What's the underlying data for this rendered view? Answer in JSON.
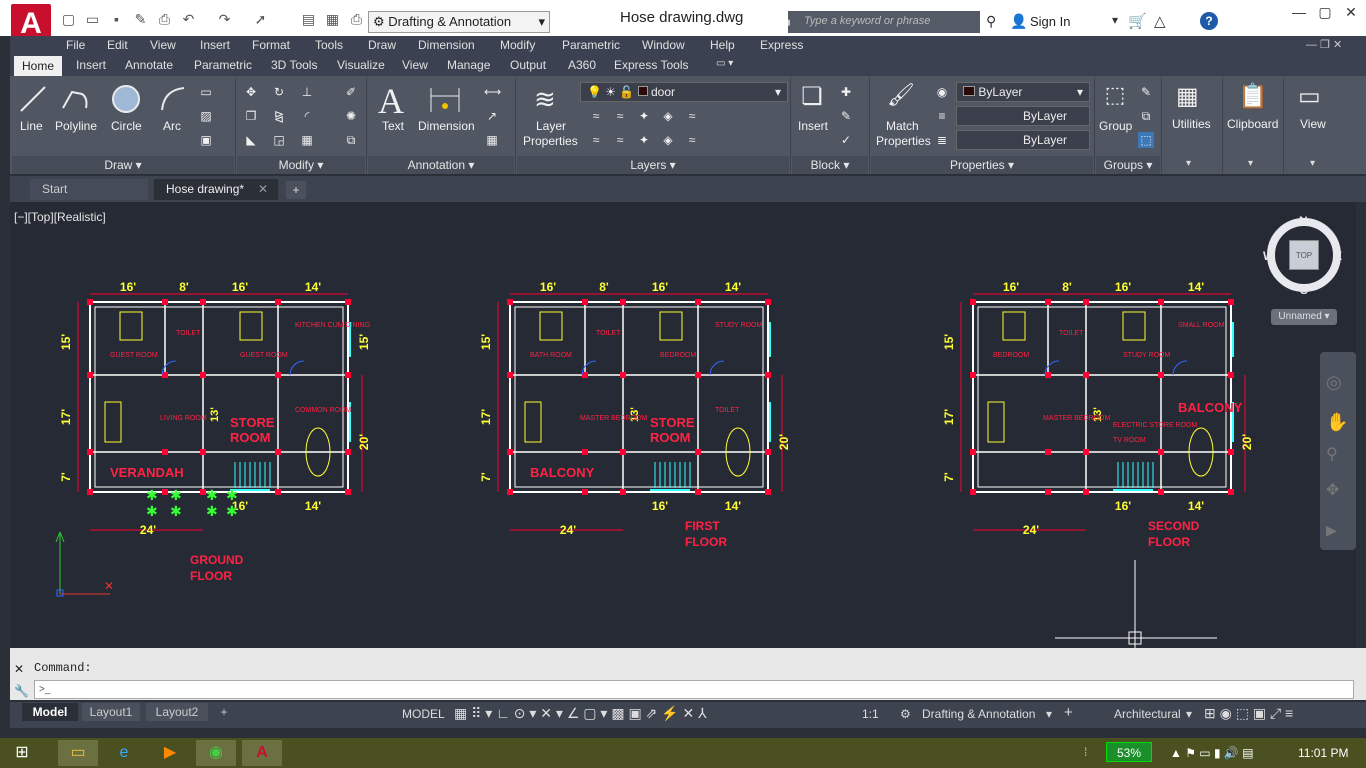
{
  "titlebar": {
    "workspace": "Drafting & Annotation",
    "doc_title": "Hose drawing.dwg",
    "search_placeholder": "Type a keyword or phrase",
    "sign_in": "Sign In",
    "app_logo": "A"
  },
  "menu": [
    "File",
    "Edit",
    "View",
    "Insert",
    "Format",
    "Tools",
    "Draw",
    "Dimension",
    "Modify",
    "Parametric",
    "Window",
    "Help",
    "Express"
  ],
  "ribbon_tabs": [
    "Home",
    "Insert",
    "Annotate",
    "Parametric",
    "3D Tools",
    "Visualize",
    "View",
    "Manage",
    "Output",
    "A360",
    "Express Tools"
  ],
  "ribbon": {
    "draw": {
      "line": "Line",
      "polyline": "Polyline",
      "circle": "Circle",
      "arc": "Arc",
      "title": "Draw ▾"
    },
    "modify": {
      "title": "Modify ▾"
    },
    "annotation": {
      "text": "Text",
      "dimension": "Dimension",
      "title": "Annotation ▾"
    },
    "layers": {
      "layer_props_1": "Layer",
      "layer_props_2": "Properties",
      "current_layer": "door",
      "title": "Layers ▾"
    },
    "block": {
      "insert": "Insert",
      "title": "Block ▾"
    },
    "properties": {
      "match_1": "Match",
      "match_2": "Properties",
      "color": "ByLayer",
      "linetype": "ByLayer",
      "lineweight": "ByLayer",
      "title": "Properties ▾"
    },
    "groups": {
      "group": "Group",
      "title": "Groups ▾"
    },
    "utilities": "Utilities",
    "clipboard": "Clipboard",
    "view": "View"
  },
  "doc_tabs": {
    "start": "Start",
    "active": "Hose drawing*"
  },
  "viewport_label": "[−][Top][Realistic]",
  "viewcube": {
    "n": "N",
    "s": "S",
    "e": "E",
    "w": "W",
    "face": "TOP",
    "ucs": "Unnamed ▾"
  },
  "drawing": {
    "plans": [
      {
        "name1": "GROUND",
        "name2": "FLOOR",
        "dims_top": [
          "16'",
          "8'",
          "16'",
          "14'"
        ],
        "dims_left": [
          "15'",
          "17'",
          "7'"
        ],
        "dims_right": [
          "15'",
          "20'"
        ],
        "dims_bottom": [
          "24'",
          "16'",
          "14'"
        ],
        "rooms": [
          "GUEST ROOM",
          "TOILET",
          "GUEST ROOM",
          "KITCHEN CUM DINING",
          "LIVING ROOM",
          "STORE",
          "ROOM",
          "COMMON ROOM",
          "VERANDAH"
        ],
        "dim_13": "13'"
      },
      {
        "name1": "FIRST",
        "name2": "FLOOR",
        "dims_top": [
          "16'",
          "8'",
          "16'",
          "14'"
        ],
        "dims_left": [
          "15'",
          "17'",
          "7'"
        ],
        "dims_right": [
          "20'"
        ],
        "dims_bottom": [
          "24'",
          "16'",
          "14'"
        ],
        "rooms": [
          "BATH ROOM",
          "TOILET",
          "BEDROOM",
          "STUDY ROOM",
          "MASTER BEDROOM",
          "STORE",
          "ROOM",
          "TOILET",
          "BALCONY"
        ],
        "dim_13": "13'"
      },
      {
        "name1": "SECOND",
        "name2": "FLOOR",
        "dims_top": [
          "16'",
          "8'",
          "16'",
          "14'"
        ],
        "dims_left": [
          "15'",
          "17'",
          "7'"
        ],
        "dims_right": [
          "20'"
        ],
        "dims_bottom": [
          "24'",
          "16'",
          "14'"
        ],
        "rooms": [
          "BEDROOM",
          "TOILET",
          "STUDY ROOM",
          "SMALL ROOM",
          "MASTER BEDROOM",
          "ELECTRIC STORE ROOM",
          "TV ROOM",
          "BALCONY"
        ],
        "dim_13": "13'"
      }
    ]
  },
  "command": {
    "history": "Command:",
    "prompt_icon": ">_"
  },
  "layout_tabs": [
    "Model",
    "Layout1",
    "Layout2"
  ],
  "status": {
    "model": "MODEL",
    "scale": "1:1",
    "workspace": "Drafting & Annotation",
    "units": "Architectural"
  },
  "taskbar": {
    "battery": "53%",
    "time": "11:01 PM"
  },
  "colors": {
    "accent": "#c8102e",
    "wall": "#ffffff",
    "dimension": "#ffff33",
    "room_label": "#ff2244",
    "door": "#33ffff",
    "column": "#ff0033",
    "tree": "#33ff33"
  }
}
